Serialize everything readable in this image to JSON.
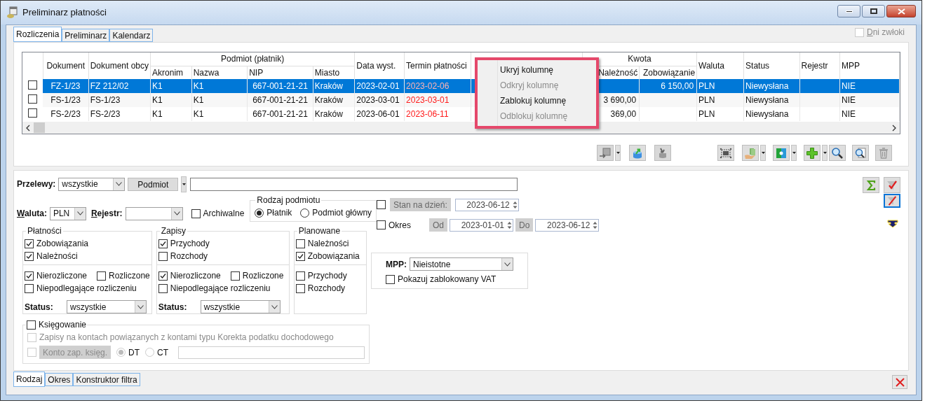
{
  "window": {
    "title": "Preliminarz płatności"
  },
  "tabs": [
    {
      "label": "Rozliczenia",
      "selected": true
    },
    {
      "label": "Preliminarz",
      "selected": false
    },
    {
      "label": "Kalendarz",
      "selected": false
    }
  ],
  "dni_zwloki": {
    "label": "Dni zwłoki",
    "checked": false
  },
  "table": {
    "columns": [
      {
        "label": "Dokument"
      },
      {
        "label": "Dokument obcy"
      },
      {
        "label": "Podmiot (płatnik)",
        "children": [
          "Akronim",
          "Nazwa",
          "NIP",
          "Miasto"
        ]
      },
      {
        "label": "Data wyst."
      },
      {
        "label": "Termin płatności"
      },
      {
        "label": "Kwota",
        "children": [
          "Należność",
          "Zobowiązanie"
        ]
      },
      {
        "label": "Waluta"
      },
      {
        "label": "Status"
      },
      {
        "label": "Rejestr"
      },
      {
        "label": "MPP"
      }
    ],
    "rows": [
      {
        "selected": true,
        "checked": false,
        "dokument": "FZ-1/23",
        "dokument_obcy": "FZ 212/02",
        "akronim": "K1",
        "nazwa": "K1",
        "nip": "667-001-21-21",
        "miasto": "Kraków",
        "data_wyst": "2023-02-01",
        "termin": "2023-02-06",
        "zobowiazanie": "6 150,00",
        "waluta": "PLN",
        "status": "Niewysłana",
        "mpp": "NIE"
      },
      {
        "selected": false,
        "checked": false,
        "dokument": "FS-1/23",
        "dokument_obcy": "FS-1/23",
        "akronim": "K1",
        "nazwa": "K1",
        "nip": "667-001-21-21",
        "miasto": "Kraków",
        "data_wyst": "2023-03-01",
        "termin": "2023-03-01",
        "naleznosc": "3 690,00",
        "waluta": "PLN",
        "status": "Niewysłana",
        "mpp": "NIE"
      },
      {
        "selected": false,
        "checked": false,
        "dokument": "FS-2/23",
        "dokument_obcy": "FS-2/23",
        "akronim": "K1",
        "nazwa": "K1",
        "nip": "667-001-21-21",
        "miasto": "Kraków",
        "data_wyst": "2023-06-01",
        "termin": "2023-06-11",
        "naleznosc": "369,00",
        "waluta": "PLN",
        "status": "Niewysłana",
        "mpp": "NIE"
      }
    ]
  },
  "context_menu": {
    "items": [
      {
        "label": "Ukryj kolumnę",
        "disabled": false
      },
      {
        "label": "Odkryj kolumnę",
        "disabled": true
      },
      {
        "label": "Zablokuj kolumnę",
        "disabled": false
      },
      {
        "label": "Odblokuj kolumnę",
        "disabled": true
      }
    ]
  },
  "filters": {
    "przelewy": {
      "label": "Przelewy:",
      "value": "wszystkie"
    },
    "podmiot_button": "Podmiot",
    "waluta": {
      "label": "Waluta:",
      "value": "PLN"
    },
    "rejestr": {
      "label": "Rejestr:"
    },
    "archiwalne": {
      "label": "Archiwalne",
      "checked": false
    },
    "rodzaj_podmiotu": {
      "title": "Rodzaj podmiotu",
      "options": [
        {
          "label": "Płatnik",
          "selected": true
        },
        {
          "label": "Podmiot główny",
          "selected": false
        }
      ]
    },
    "groups": [
      {
        "title": "Płatności",
        "top": [
          {
            "label": "Zobowiązania",
            "checked": true
          },
          {
            "label": "Należności",
            "checked": true
          }
        ],
        "bottom": [
          {
            "items": [
              {
                "label": "Nierozliczone",
                "checked": true
              },
              {
                "label": "Rozliczone",
                "checked": false
              }
            ]
          },
          {
            "items": [
              {
                "label": "Niepodlegające rozliczeniu",
                "checked": false
              }
            ]
          }
        ],
        "status": {
          "label": "Status:",
          "value": "wszystkie"
        }
      },
      {
        "title": "Zapisy",
        "top": [
          {
            "label": "Przychody",
            "checked": true
          },
          {
            "label": "Rozchody",
            "checked": false
          }
        ],
        "bottom": [
          {
            "items": [
              {
                "label": "Nierozliczone",
                "checked": true
              },
              {
                "label": "Rozliczone",
                "checked": false
              }
            ]
          },
          {
            "items": [
              {
                "label": "Niepodlegające rozliczeniu",
                "checked": false
              }
            ]
          }
        ],
        "status": {
          "label": "Status:",
          "value": "wszystkie"
        }
      },
      {
        "title": "Planowane",
        "top": [
          {
            "label": "Należności",
            "checked": false
          },
          {
            "label": "Zobowiązania",
            "checked": true
          }
        ],
        "bottom": [
          {
            "items": [
              {
                "label": "Przychody",
                "checked": false
              }
            ]
          },
          {
            "items": [
              {
                "label": "Rozchody",
                "checked": false
              }
            ]
          }
        ]
      }
    ],
    "ksiegowanie": {
      "label": "Księgowanie",
      "checked": false,
      "zapisy": {
        "label": "Zapisy na kontach powiązanych z kontami typu Korekta podatku dochodowego",
        "checked": false,
        "disabled": true
      },
      "konto": {
        "checked": false,
        "disabled": true,
        "button": "Konto zap. księg.",
        "options": [
          {
            "label": "DT",
            "selected": true
          },
          {
            "label": "CT",
            "selected": false
          }
        ]
      }
    },
    "stan_na_dzien": {
      "checked": false,
      "button": "Stan na dzień:",
      "value": "2023-06-12"
    },
    "okres": {
      "label": "Okres",
      "checked": false,
      "od": "Od",
      "od_value": "2023-01-01",
      "do": "Do",
      "do_value": "2023-06-12"
    },
    "mpp": {
      "label": "MPP:",
      "value": "Nieistotne",
      "vat": {
        "label": "Pokazuj zablokowany VAT",
        "checked": false
      }
    }
  },
  "bottom_tabs": [
    {
      "label": "Rodzaj",
      "selected": true
    },
    {
      "label": "Okres",
      "selected": false
    },
    {
      "label": "Konstruktor filtra",
      "selected": false
    }
  ]
}
